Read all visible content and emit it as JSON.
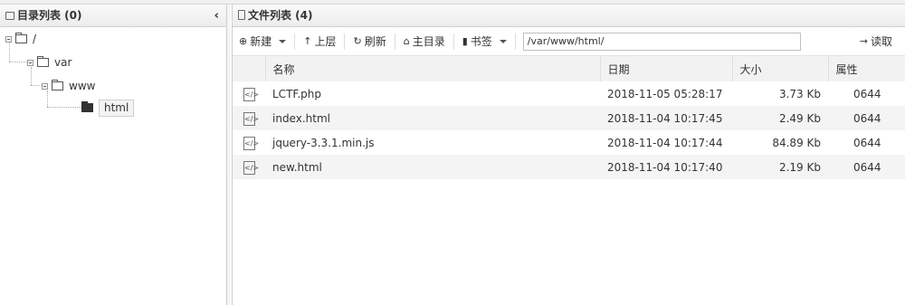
{
  "left": {
    "title": "目录列表 (0)",
    "collapse_glyph": "‹",
    "tree": [
      {
        "label": "/"
      },
      {
        "label": "var"
      },
      {
        "label": "www"
      },
      {
        "label": "html",
        "selected": true
      }
    ]
  },
  "right": {
    "title": "文件列表 (4)",
    "toolbar": {
      "new": "新建",
      "up": "上层",
      "refresh": "刷新",
      "home": "主目录",
      "bookmarks": "书签",
      "path": "/var/www/html/",
      "read": "读取"
    },
    "columns": [
      "名称",
      "日期",
      "大小",
      "属性"
    ],
    "files": [
      {
        "name": "LCTF.php",
        "date": "2018-11-05 05:28:17",
        "size": "3.73 Kb",
        "perm": "0644"
      },
      {
        "name": "index.html",
        "date": "2018-11-04 10:17:45",
        "size": "2.49 Kb",
        "perm": "0644"
      },
      {
        "name": "jquery-3.3.1.min.js",
        "date": "2018-11-04 10:17:44",
        "size": "84.89 Kb",
        "perm": "0644"
      },
      {
        "name": "new.html",
        "date": "2018-11-04 10:17:40",
        "size": "2.19 Kb",
        "perm": "0644"
      }
    ]
  }
}
